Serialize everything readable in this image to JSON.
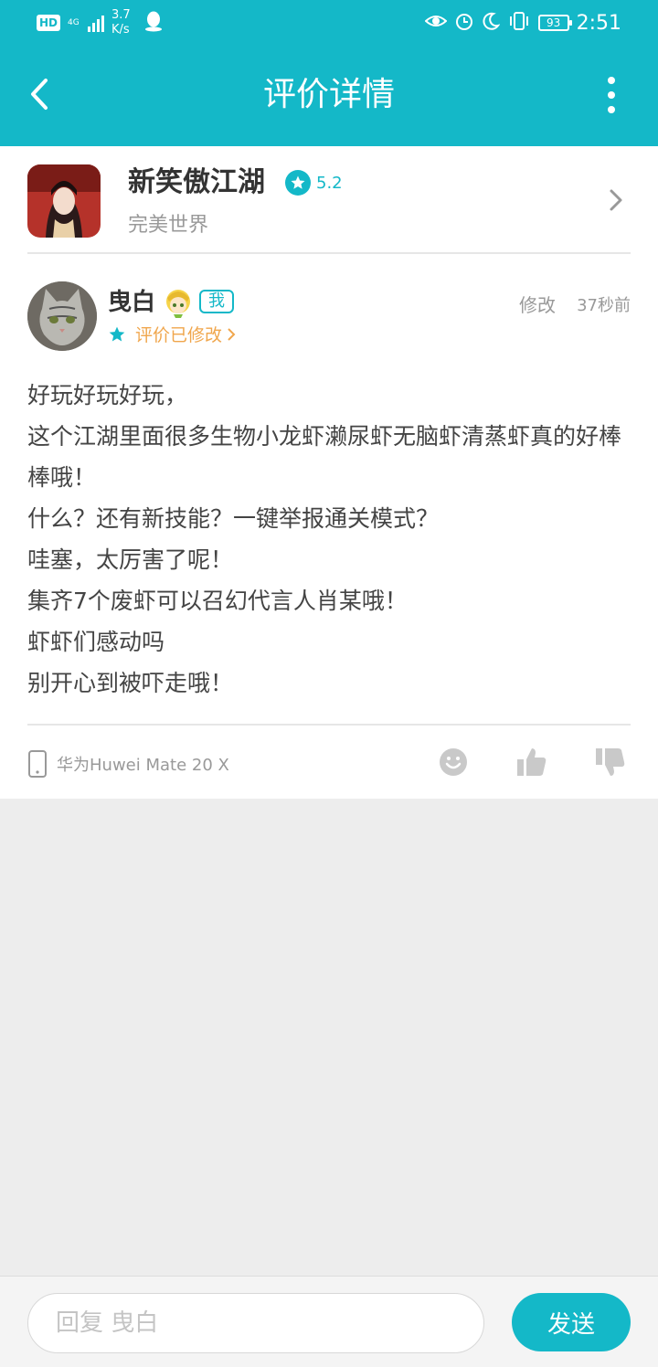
{
  "status_bar": {
    "hd": "HD",
    "network": "4G",
    "speed_value": "3.7",
    "speed_unit": "K/s",
    "battery": "93",
    "time": "2:51"
  },
  "header": {
    "title": "评价详情"
  },
  "game": {
    "name": "新笑傲江湖",
    "rating": "5.2",
    "publisher": "完美世界"
  },
  "review": {
    "username": "曳白",
    "me_tag": "我",
    "rating_stars": 1,
    "modified_label": "评价已修改",
    "edit_label": "修改",
    "time_ago": "37秒前",
    "lines": [
      "好玩好玩好玩，",
      "这个江湖里面很多生物小龙虾濑尿虾无脑虾清蒸虾真的好棒棒哦！",
      "什么？还有新技能？一键举报通关模式？",
      "哇塞，太厉害了呢！",
      "集齐7个废虾可以召幻代言人肖某哦！",
      "虾虾们感动吗",
      "别开心到被吓走哦！"
    ],
    "device": "华为Huwei Mate 20 X"
  },
  "reply": {
    "placeholder": "回复 曳白",
    "send_label": "发送"
  },
  "colors": {
    "accent": "#14b8c8",
    "orange": "#f0a64c",
    "background": "#ededed"
  }
}
